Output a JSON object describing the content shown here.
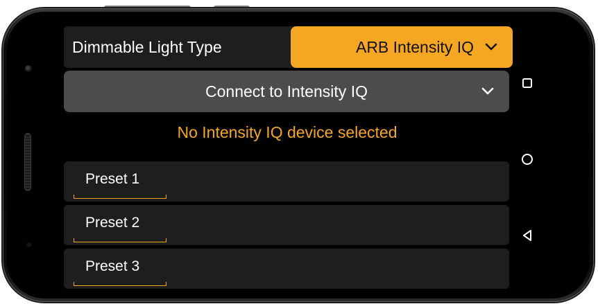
{
  "settings": {
    "light_type_label": "Dimmable Light Type",
    "light_type_value": "ARB Intensity IQ",
    "connect_label": "Connect to Intensity IQ",
    "status_message": "No Intensity IQ device selected"
  },
  "presets": [
    {
      "label": "Preset 1"
    },
    {
      "label": "Preset 2"
    },
    {
      "label": "Preset 3"
    }
  ],
  "navigation": {
    "recents_icon": "square-icon",
    "home_icon": "circle-icon",
    "back_icon": "triangle-back-icon"
  },
  "colors": {
    "accent": "#f5a623",
    "row_background": "#1e1e1e",
    "connect_background": "#4c4c4c",
    "screen_background": "#000000"
  }
}
